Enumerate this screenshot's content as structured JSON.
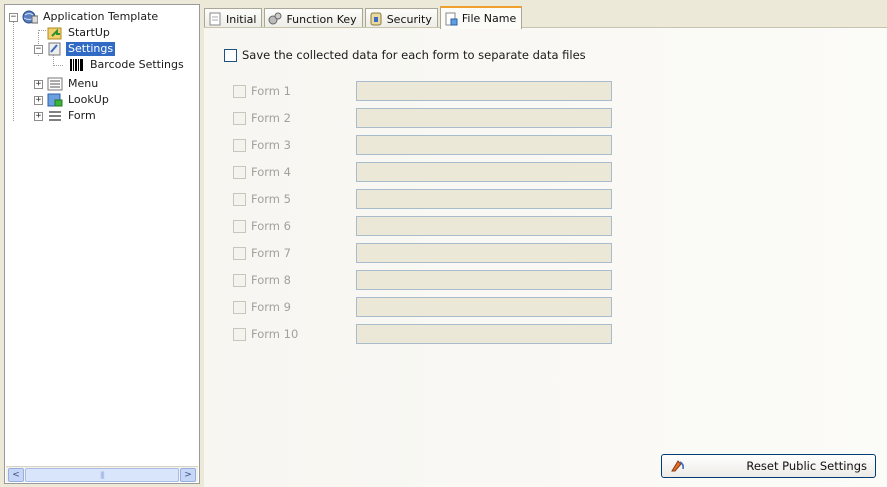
{
  "tree": {
    "items": [
      {
        "label": "Application Template",
        "expander": "−"
      },
      {
        "label": "StartUp"
      },
      {
        "label": "Settings",
        "expander": "−",
        "selected": true
      },
      {
        "label": "Barcode Settings"
      },
      {
        "label": "Menu",
        "expander": "+"
      },
      {
        "label": "LookUp",
        "expander": "+"
      },
      {
        "label": "Form",
        "expander": "+"
      }
    ]
  },
  "scrollbar": {
    "left_arrow": "<",
    "right_arrow": ">",
    "grip": "|||"
  },
  "tabs": [
    {
      "label": "Initial",
      "icon": "document-icon"
    },
    {
      "label": "Function Key",
      "icon": "gears-icon"
    },
    {
      "label": "Security",
      "icon": "shield-icon"
    },
    {
      "label": "File Name",
      "icon": "file-save-icon",
      "active": true
    }
  ],
  "file_name": {
    "save_separate_label": "Save the collected data for each form to separate data files",
    "forms": [
      "Form 1",
      "Form 2",
      "Form 3",
      "Form 4",
      "Form 5",
      "Form 6",
      "Form 7",
      "Form 8",
      "Form 9",
      "Form 10"
    ]
  },
  "reset_button": {
    "label": "Reset Public Settings",
    "icon": "reset-icon"
  },
  "colors": {
    "selection": "#316ac5",
    "active_tab_accent": "#f0a02c",
    "input_disabled_bg": "#ebe8d8"
  }
}
